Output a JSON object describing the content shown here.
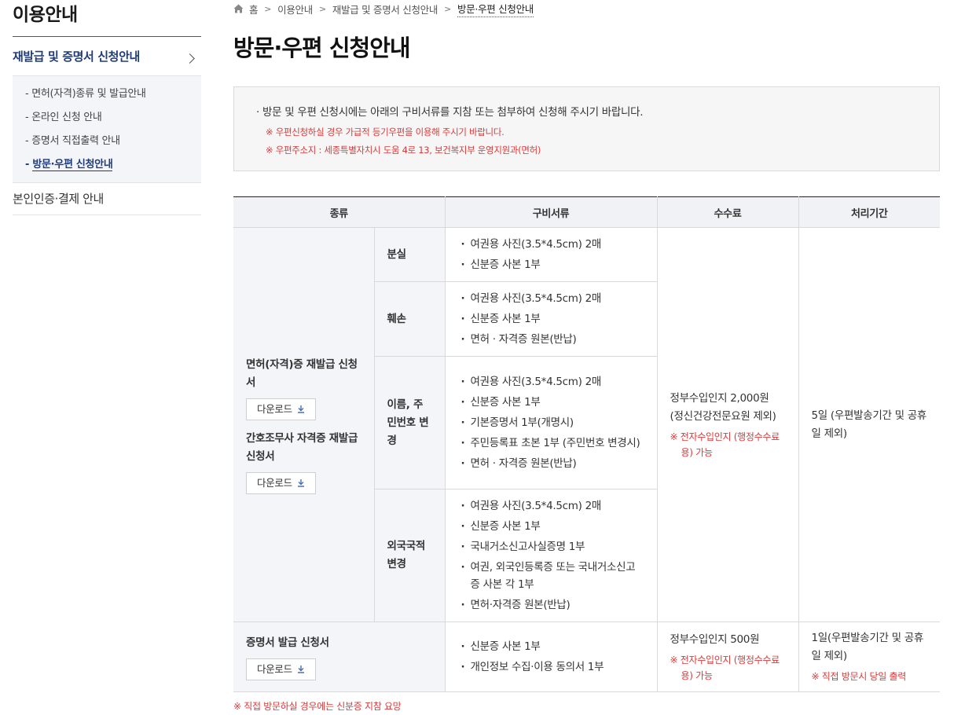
{
  "sidebar": {
    "title": "이용안내",
    "main_item": "재발급 및 증명서 신청안내",
    "sub_items": [
      {
        "label": "면허(자격)종류 및 발급안내"
      },
      {
        "label": "온라인 신청 안내"
      },
      {
        "label": "증명서 직접출력 안내"
      },
      {
        "label": "방문·우편 신청안내"
      }
    ],
    "second_item": "본인인증·결제 안내"
  },
  "breadcrumb": {
    "home": "홈",
    "items": [
      "이용안내",
      "재발급 및 증명서 신청안내"
    ],
    "current": "방문·우편 신청안내"
  },
  "page_title": "방문·우편 신청안내",
  "notice": {
    "main": "방문 및 우편 신청시에는 아래의 구비서류를 지참 또는 첨부하여 신청해 주시기 바랍니다.",
    "red1": "※ 우편신청하실 경우 가급적 등기우편을 이용해 주시기 바랍니다.",
    "red2": "※ 우편주소지 : 세종특별자치시 도움 4로 13, 보건복지부 운영지원과(면허)"
  },
  "table": {
    "headers": [
      "종류",
      "구비서류",
      "수수료",
      "처리기간"
    ],
    "group1": {
      "form1": "면허(자격)증 재발급 신청서",
      "form2": "간호조무사 자격증 재발급 신청서",
      "download": "다운로드",
      "rows": [
        {
          "type": "분실",
          "docs": [
            "여권용 사진(3.5*4.5cm) 2매",
            "신분증 사본 1부"
          ]
        },
        {
          "type": "훼손",
          "docs": [
            "여권용 사진(3.5*4.5cm) 2매",
            "신분증 사본 1부",
            "면허 · 자격증 원본(반납)"
          ]
        },
        {
          "type": "이름, 주민번호 변경",
          "docs": [
            "여권용 사진(3.5*4.5cm) 2매",
            "신분증 사본 1부",
            "기본증명서 1부(개명시)",
            "주민등록표 초본 1부 (주민번호 변경시)",
            "면허 · 자격증 원본(반납)"
          ]
        },
        {
          "type": "외국국적 변경",
          "docs": [
            "여권용 사진(3.5*4.5cm) 2매",
            "신분증 사본 1부",
            "국내거소신고사실증명 1부",
            "여권, 외국인등록증 또는 국내거소신고증 사본 각 1부",
            "면허·자격증 원본(반납)"
          ]
        }
      ],
      "fee": "정부수입인지 2,000원 (정신건강전문요원 제외)",
      "fee_note": "※ 전자수입인지 (행정수수료용) 가능",
      "period": "5일 (우편발송기간 및 공휴일 제외)"
    },
    "group2": {
      "form": "증명서 발급 신청서",
      "download": "다운로드",
      "docs": [
        "신분증 사본 1부",
        "개인정보 수집·이용 동의서 1부"
      ],
      "fee": "정부수입인지 500원",
      "fee_note": "※ 전자수입인지 (행정수수료용) 가능",
      "period": "1일(우편발송기간 및 공휴일 제외)",
      "period_note": "※ 직접 방문시 당일 출력"
    }
  },
  "footnote": "※ 직접 방문하실 경우에는 신분증 지참 요망"
}
